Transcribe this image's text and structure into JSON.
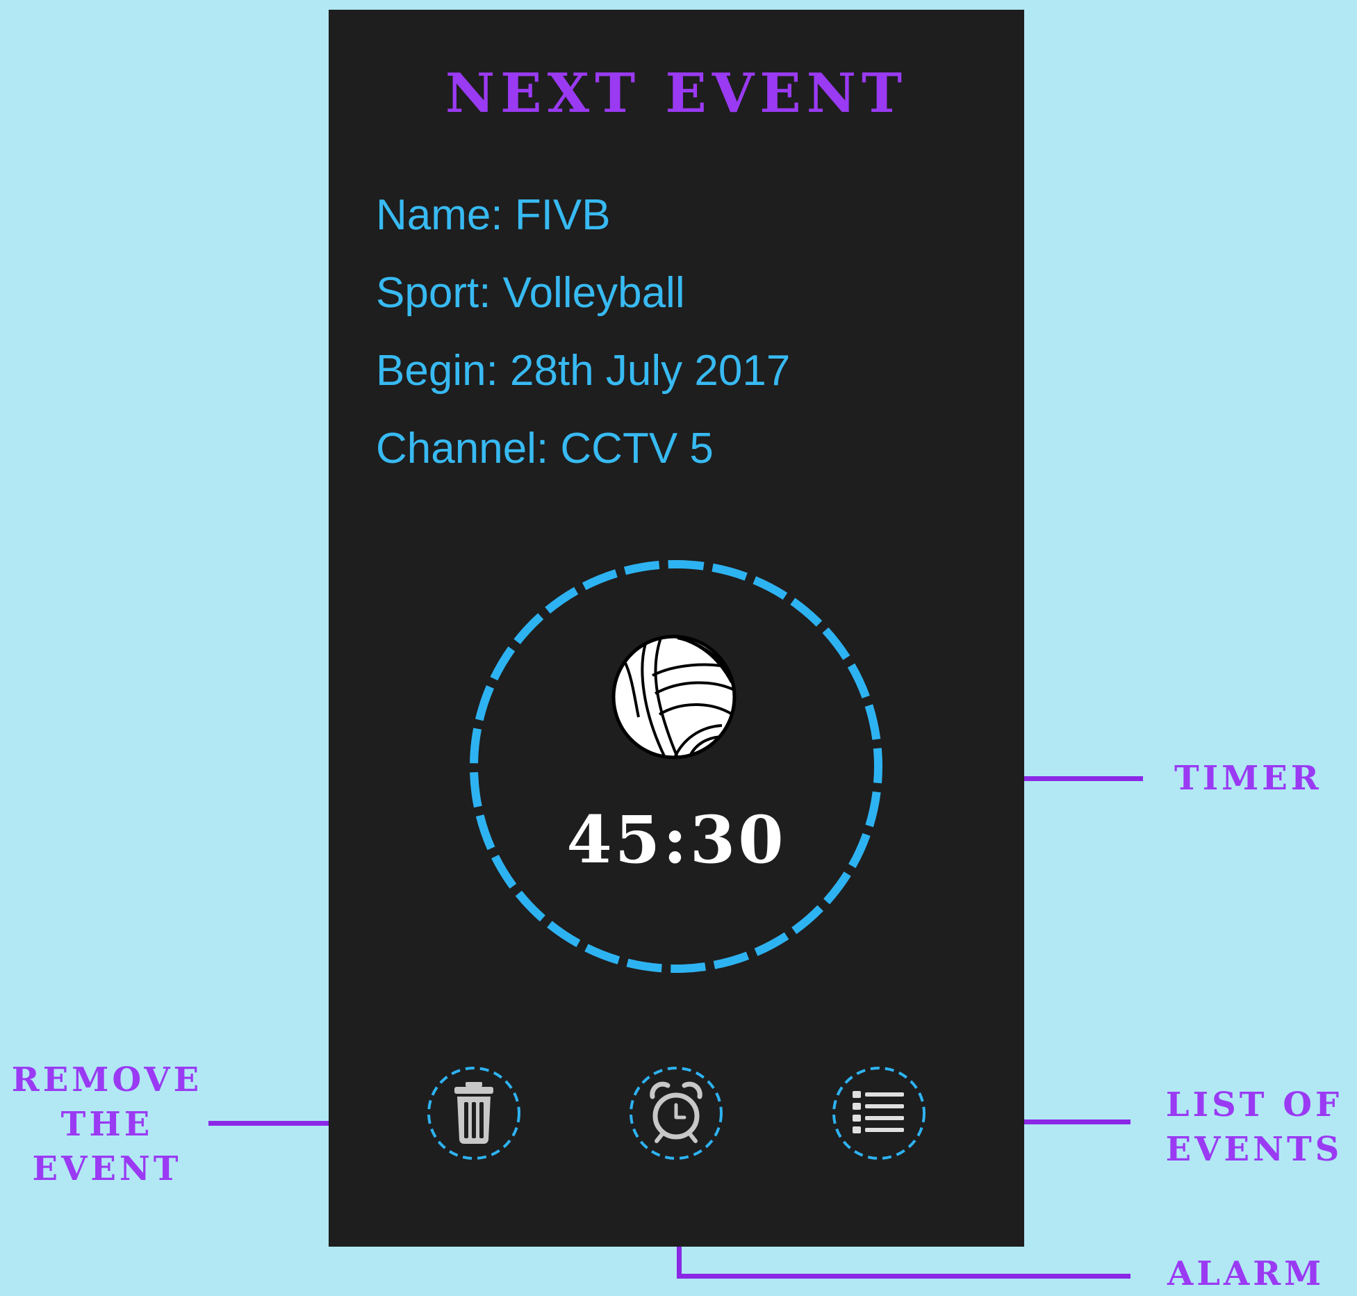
{
  "app": {
    "heading": "NEXT EVENT"
  },
  "event": {
    "name_line": "Name: FIVB",
    "sport_line": "Sport: Volleyball",
    "begin_line": "Begin: 28th July 2017",
    "channel_line": "Channel: CCTV 5"
  },
  "timer": {
    "countdown": "45:30",
    "sport_icon": "volleyball-icon"
  },
  "actions": [
    {
      "icon": "trash-icon",
      "purpose": "remove event"
    },
    {
      "icon": "alarm-clock-icon",
      "purpose": "alarm"
    },
    {
      "icon": "list-icon",
      "purpose": "list of events"
    }
  ],
  "annotations": {
    "timer": "TIMER",
    "remove_line1": "REMOVE",
    "remove_line2": "THE",
    "remove_line3": "EVENT",
    "list_line1": "LIST OF",
    "list_line2": "EVENTS",
    "alarm": "ALARM"
  },
  "colors": {
    "background": "#b1e8f4",
    "panel": "#1e1e1e",
    "accent_purple": "#9a3af3",
    "accent_blue": "#38baf2",
    "text_white": "#ffffff",
    "icon_grey": "#c8c8c8"
  }
}
